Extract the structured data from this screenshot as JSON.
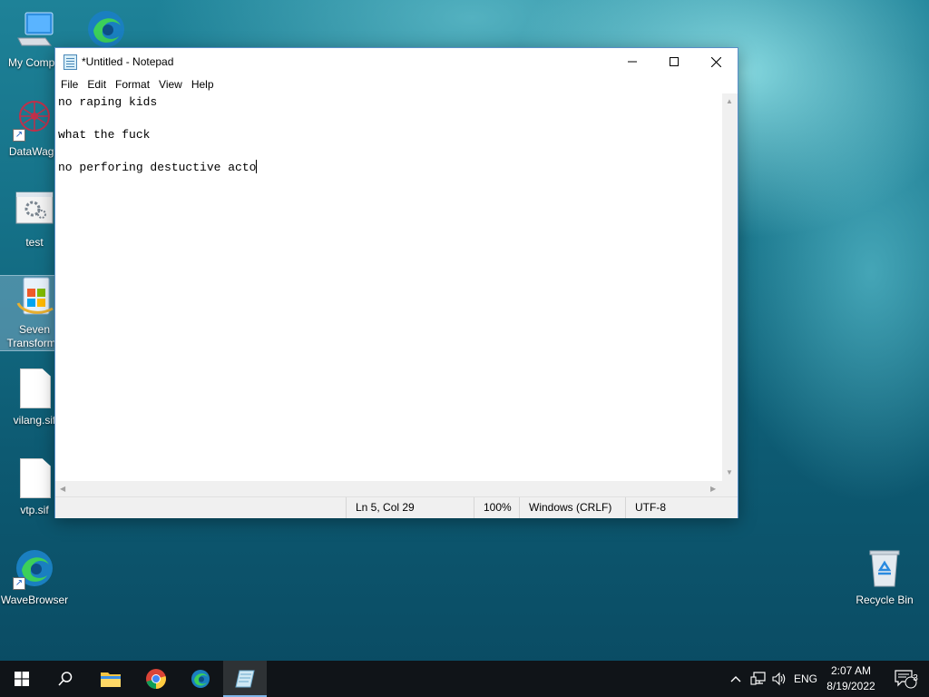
{
  "desktop": {
    "icons": [
      {
        "label": "My Compu"
      },
      {
        "label": ""
      },
      {
        "label": "DataWago"
      },
      {
        "label": "test"
      },
      {
        "label": "Seven Transforma"
      },
      {
        "label": "vilang.sif"
      },
      {
        "label": "vtp.sif"
      },
      {
        "label": "WaveBrowser"
      },
      {
        "label": "Recycle Bin"
      }
    ]
  },
  "notepad": {
    "title": "*Untitled - Notepad",
    "menu": [
      "File",
      "Edit",
      "Format",
      "View",
      "Help"
    ],
    "lines": [
      "no raping kids",
      "",
      "what the fuck",
      "",
      "no perforing destuctive acto"
    ],
    "status": {
      "position": "Ln 5, Col 29",
      "zoom": "100%",
      "line_ending": "Windows (CRLF)",
      "encoding": "UTF-8"
    }
  },
  "taskbar": {
    "language": "ENG",
    "time": "2:07 AM",
    "date": "8/19/2022",
    "notification_count": "3"
  },
  "colors": {
    "taskbar": "#101418",
    "window_border": "#5a8fc8",
    "desktop": "#146f86"
  }
}
